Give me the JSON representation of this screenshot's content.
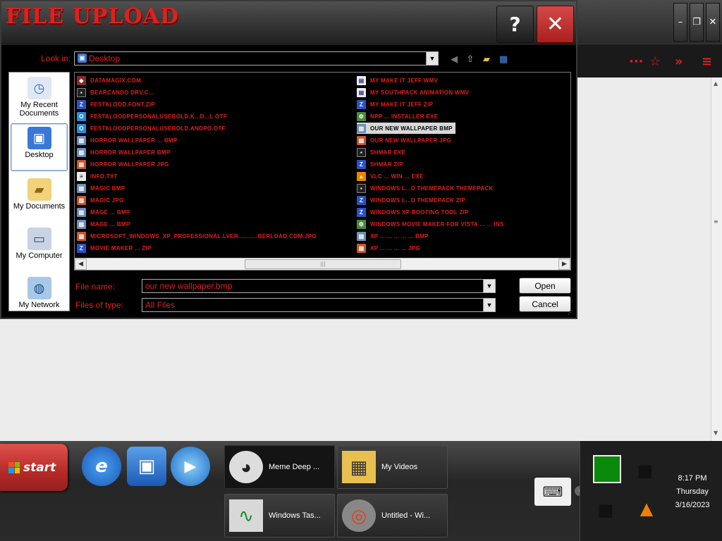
{
  "dialog": {
    "title": "FILE UPLOAD",
    "help_label": "?",
    "close_label": "✕",
    "look_in_label": "Look in:",
    "look_in_value": "Desktop",
    "file_name_label": "File name:",
    "file_name_value": "our new wallpaper.bmp",
    "file_type_label": "Files of type:",
    "file_type_value": "All Files",
    "open_label": "Open",
    "cancel_label": "Cancel"
  },
  "places": [
    {
      "label": "My Recent Documents",
      "icon": "recent-documents-icon"
    },
    {
      "label": "Desktop",
      "icon": "desktop-icon"
    },
    {
      "label": "My Documents",
      "icon": "my-documents-icon"
    },
    {
      "label": "My Computer",
      "icon": "my-computer-icon"
    },
    {
      "label": "My Network",
      "icon": "my-network-icon"
    }
  ],
  "files_left": [
    {
      "name": "DATAMAGIX.COM",
      "type": "url"
    },
    {
      "name": "BEARCANDO DRV.C...",
      "type": "cmd"
    },
    {
      "name": "FESTALOOD.FONT.ZIP",
      "type": "zip"
    },
    {
      "name": "FESTALOODPERSONALUSEBOLD.K...D...L.OTF",
      "type": "otf"
    },
    {
      "name": "FESTALOODPERSONALUSEBOLD.ANDPO.OTF",
      "type": "otf"
    },
    {
      "name": "HORROR WALLPAPER ... BMP",
      "type": "bmp"
    },
    {
      "name": "HORROR WALLPAPER BMP",
      "type": "bmp"
    },
    {
      "name": "HORROR WALLPAPER JPG",
      "type": "jpg"
    },
    {
      "name": "INFO.TXT",
      "type": "txt"
    },
    {
      "name": "MAGIC BMP",
      "type": "bmp"
    },
    {
      "name": "MAGIC JPG",
      "type": "jpg"
    },
    {
      "name": "MAGE ... BMP",
      "type": "bmp"
    },
    {
      "name": "MAGE ... BMP",
      "type": "bmp"
    },
    {
      "name": "MICROSOFT_WINDOWS_XP_PROFESSIONAL.LVER...........BERLOAD.COM.JPG",
      "type": "jpg"
    },
    {
      "name": "MOVIE MAKER ... ZIP",
      "type": "zip"
    }
  ],
  "files_right": [
    {
      "name": "MY MAKE IT JEFF WMV",
      "type": "wmv"
    },
    {
      "name": "MY SOUTHPACK ANIMATION WMV",
      "type": "wmv"
    },
    {
      "name": "MY MAKE IT JEFF ZIP",
      "type": "zip"
    },
    {
      "name": "NPP ... INSTALLER EXE",
      "type": "exe"
    },
    {
      "name": "OUR NEW WALLPAPER BMP",
      "type": "bmp",
      "selected": true
    },
    {
      "name": "OUR NEW WALLPAPER JPG",
      "type": "jpg"
    },
    {
      "name": "SHMAR EXE",
      "type": "cmd"
    },
    {
      "name": "SHMAR ZIP",
      "type": "zip"
    },
    {
      "name": "VLC ... WIN ... EXE",
      "type": "vlc"
    },
    {
      "name": "WINDOWS L...D THEMEPACK THEMEPACK",
      "type": "cmd"
    },
    {
      "name": "WINDOWS L...D THEMEPACK ZIP",
      "type": "zip"
    },
    {
      "name": "WINDOWS XP BOOTING TOOL ZIP",
      "type": "zip"
    },
    {
      "name": "WINDOWS MOVIE MAKER FOR VISTA ... ... INS",
      "type": "exe"
    },
    {
      "name": "XP ... ... ... ... ... BMP",
      "type": "bmp"
    },
    {
      "name": "XP ... ... ... ... JPG",
      "type": "jpg"
    }
  ],
  "taskbar": {
    "start_label": "start",
    "buttons": [
      {
        "label": "Meme Deep ...",
        "icon": "raccoon-icon",
        "active": true
      },
      {
        "label": "My Videos",
        "icon": "videos-folder-icon",
        "active": false
      },
      {
        "label": "Windows Tas...",
        "icon": "task-manager-icon",
        "active": false
      },
      {
        "label": "Untitled - Wi...",
        "icon": "movie-maker-icon",
        "active": false
      }
    ],
    "clock": {
      "time": "8:17 PM",
      "day": "Thursday",
      "date": "3/16/2023"
    }
  },
  "browser": {
    "toolbar_icons": [
      "more-icon",
      "star-icon",
      "overflow-icon",
      "menu-icon"
    ]
  },
  "colors": {
    "accent": "#e0201c",
    "taskbar": "#2a2a2a",
    "start": "#c0302c"
  }
}
